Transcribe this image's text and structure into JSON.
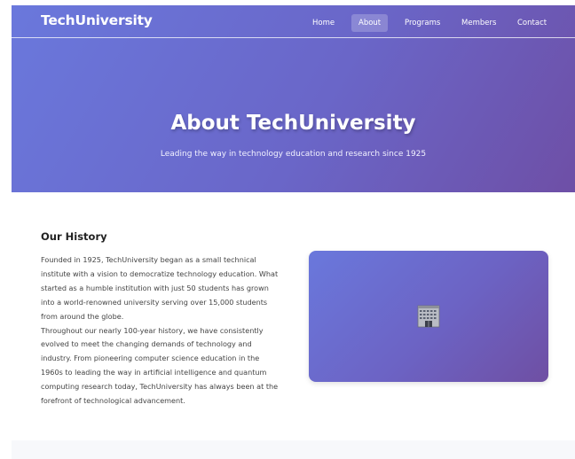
{
  "header": {
    "brand": "TechUniversity",
    "nav": [
      {
        "label": "Home",
        "active": false
      },
      {
        "label": "About",
        "active": true
      },
      {
        "label": "Programs",
        "active": false
      },
      {
        "label": "Members",
        "active": false
      },
      {
        "label": "Contact",
        "active": false
      }
    ]
  },
  "hero": {
    "title": "About TechUniversity",
    "subtitle": "Leading the way in technology education and research since 1925"
  },
  "history": {
    "heading": "Our History",
    "paragraphs": [
      "Founded in 1925, TechUniversity began as a small technical institute with a vision to democratize technology education. What started as a humble institution with just 50 students has grown into a world-renowned university serving over 15,000 students from around the globe.",
      "Throughout our nearly 100-year history, we have consistently evolved to meet the changing demands of technology and industry. From pioneering computer science education in the 1960s to leading the way in artificial intelligence and quantum computing research today, TechUniversity has always been at the forefront of technological advancement."
    ],
    "image_icon": "office-building-icon"
  },
  "colors": {
    "gradient_start": "#6a78dc",
    "gradient_end": "#6e4fa6",
    "nav_active_bg": "rgba(255,255,255,0.22)",
    "text_dark": "#222222",
    "text_body": "#444444"
  }
}
